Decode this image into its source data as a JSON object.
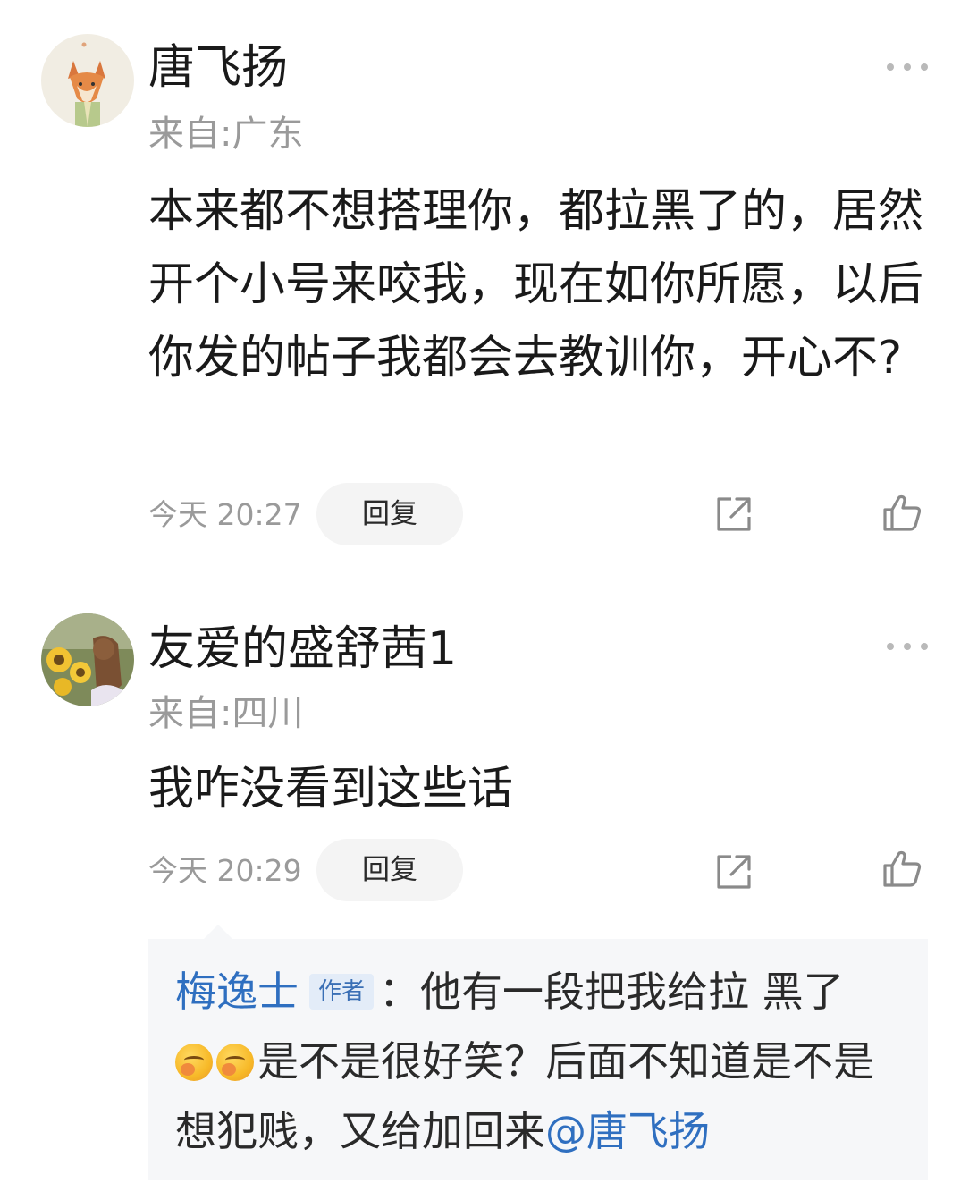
{
  "comments": [
    {
      "username": "唐飞扬",
      "location": "来自:广东",
      "text": "本来都不想搭理你，都拉黑了的，居然开个小号来咬我，现在如你所愿，以后你发的帖子我都会去教训你，开心不?",
      "time": "今天 20:27",
      "reply_label": "回复"
    },
    {
      "username": "友爱的盛舒茜1",
      "location": "来自:四川",
      "text": "我咋没看到这些话",
      "time": "今天 20:29",
      "reply_label": "回复"
    }
  ],
  "quoted_reply": {
    "author": "梅逸士",
    "badge": "作者",
    "separator": "：",
    "text_before": "他有一段把我给拉 黑了",
    "emoji_name": "covering-mouth-laugh-emoji",
    "emoji_count": 2,
    "text_after": "是不是很好笑？后面不知道是不是想犯贱，又给加回来",
    "mention": "@唐飞扬"
  },
  "colors": {
    "link_blue": "#2f6fc0",
    "muted_gray": "#9a9a9a",
    "quote_bg": "#f6f7f9"
  },
  "icons": [
    "more-options-icon",
    "share-icon",
    "like-icon"
  ]
}
